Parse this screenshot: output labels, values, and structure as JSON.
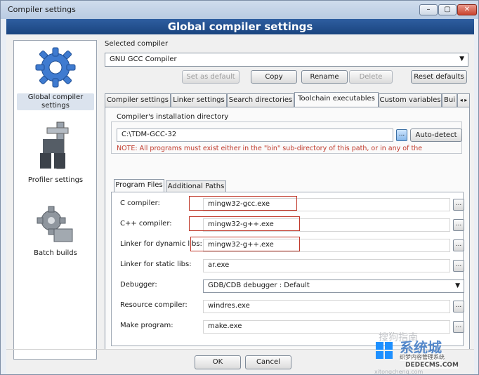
{
  "window": {
    "title": "Compiler settings"
  },
  "banner": {
    "title": "Global compiler settings"
  },
  "nav": [
    {
      "label": "Global compiler settings",
      "icon": "gear-icon"
    },
    {
      "label": "Profiler settings",
      "icon": "caliper-icon"
    },
    {
      "label": "Batch builds",
      "icon": "gears-icon"
    }
  ],
  "compiler": {
    "section_label": "Selected compiler",
    "selected": "GNU GCC Compiler",
    "buttons": {
      "set_default": "Set as default",
      "copy": "Copy",
      "rename": "Rename",
      "delete": "Delete",
      "reset": "Reset defaults"
    }
  },
  "tabs": [
    "Compiler settings",
    "Linker settings",
    "Search directories",
    "Toolchain executables",
    "Custom variables",
    "Bui"
  ],
  "install": {
    "group_label": "Compiler's installation directory",
    "path": "C:\\TDM-GCC-32",
    "ellipsis": "...",
    "autodetect": "Auto-detect",
    "note": "NOTE: All programs must exist either in the \"bin\" sub-directory of this path, or in any of the"
  },
  "subtabs": [
    "Program Files",
    "Additional Paths"
  ],
  "programs": [
    {
      "label": "C compiler:",
      "value": "mingw32-gcc.exe"
    },
    {
      "label": "C++ compiler:",
      "value": "mingw32-g++.exe"
    },
    {
      "label": "Linker for dynamic libs:",
      "value": "mingw32-g++.exe"
    },
    {
      "label": "Linker for static libs:",
      "value": "ar.exe"
    },
    {
      "label": "Debugger:",
      "value": "GDB/CDB debugger : Default"
    },
    {
      "label": "Resource compiler:",
      "value": "windres.exe"
    },
    {
      "label": "Make program:",
      "value": "make.exe"
    }
  ],
  "footer": {
    "ok": "OK",
    "cancel": "Cancel"
  },
  "watermarks": {
    "sogou": "搜狗指南",
    "site_cn": "系统城",
    "site_url": "xitongcheng.com",
    "dede_cn": "织梦内容管理系统",
    "dede_url": "DEDECMS.COM"
  },
  "colors": {
    "banner": "#1f4d8c",
    "note": "#c0392b",
    "highlight": "#c0392b"
  }
}
